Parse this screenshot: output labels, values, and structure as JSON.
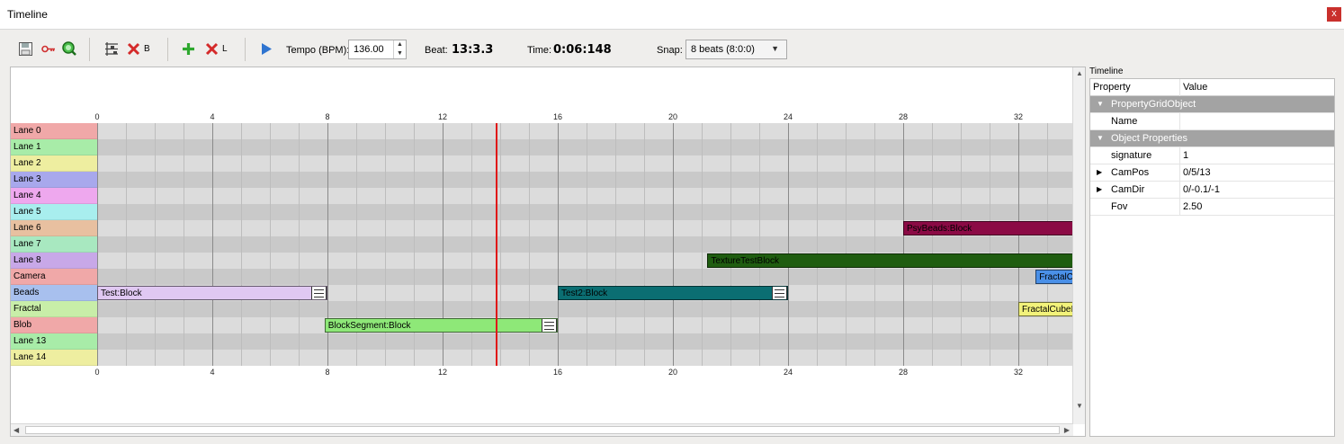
{
  "window": {
    "title": "Timeline",
    "close": "x"
  },
  "toolbar": {
    "remove_block_label": "B",
    "remove_lane_label": "L",
    "tempo_label": "Tempo (BPM):",
    "tempo_value": "136.00",
    "beat_label": "Beat:",
    "beat_value": "13:3.3",
    "time_label": "Time:",
    "time_value": "0:06:148",
    "snap_label": "Snap:",
    "snap_value": "8 beats (8:0:0)",
    "icons": [
      "save-icon",
      "key-icon",
      "zoom-icon",
      "lanes-icon",
      "delete-icon",
      "add-icon",
      "delete-icon",
      "play-icon"
    ]
  },
  "timeline": {
    "ticks": [
      "0",
      "4",
      "8",
      "12",
      "16",
      "20",
      "24",
      "28",
      "32"
    ],
    "tick_beats": [
      0,
      4,
      8,
      12,
      16,
      20,
      24,
      28,
      32
    ],
    "playhead_beat": 13.85,
    "lanes": [
      {
        "label": "Lane 0",
        "color": "#f0a8a8"
      },
      {
        "label": "Lane 1",
        "color": "#a8eca8"
      },
      {
        "label": "Lane 2",
        "color": "#eeeea0"
      },
      {
        "label": "Lane 3",
        "color": "#a8a8ec"
      },
      {
        "label": "Lane 4",
        "color": "#eea8ee"
      },
      {
        "label": "Lane 5",
        "color": "#a8eeee"
      },
      {
        "label": "Lane 6",
        "color": "#e8c0a0"
      },
      {
        "label": "Lane 7",
        "color": "#a8e8c0"
      },
      {
        "label": "Lane 8",
        "color": "#c8a8e8"
      },
      {
        "label": "Camera",
        "color": "#f0a8a8"
      },
      {
        "label": "Beads",
        "color": "#a8c0ee"
      },
      {
        "label": "Fractal",
        "color": "#c8eea8"
      },
      {
        "label": "Blob",
        "color": "#f0a8a8"
      },
      {
        "label": "Lane 13",
        "color": "#a8eca8"
      },
      {
        "label": "Lane 14",
        "color": "#eeeea0"
      }
    ],
    "blocks": [
      {
        "label": "PsyBeads:Block",
        "lane": 6,
        "start": 28,
        "end": 36,
        "color": "#8b0a45",
        "handle": false
      },
      {
        "label": "TextureTestBlock",
        "lane": 8,
        "start": 21.2,
        "end": 36,
        "color": "#1f5d10",
        "handle": false
      },
      {
        "label": "FractalC",
        "lane": 9,
        "start": 32.6,
        "end": 36,
        "color": "#4a90e8",
        "handle": false
      },
      {
        "label": "Test:Block",
        "lane": 10,
        "start": 0,
        "end": 8,
        "color": "#e0c8f2",
        "handle": true
      },
      {
        "label": "Test2:Block",
        "lane": 10,
        "start": 16,
        "end": 24,
        "color": "#0b6e72",
        "handle": true
      },
      {
        "label": "FractalCubeI",
        "lane": 11,
        "start": 32,
        "end": 36,
        "color": "#f2f27a",
        "handle": false
      },
      {
        "label": "BlockSegment:Block",
        "lane": 12,
        "start": 7.9,
        "end": 16,
        "color": "#8ee878",
        "handle": true
      }
    ]
  },
  "properties": {
    "panel_title": "Timeline",
    "header_property": "Property",
    "header_value": "Value",
    "rows": [
      {
        "type": "group",
        "key": "PropertyGridObject",
        "value": ""
      },
      {
        "type": "item",
        "key": "Name",
        "value": ""
      },
      {
        "type": "group",
        "key": "Object Properties",
        "value": ""
      },
      {
        "type": "item",
        "key": "signature",
        "value": "1"
      },
      {
        "type": "expandable",
        "key": "CamPos",
        "value": "0/5/13"
      },
      {
        "type": "expandable",
        "key": "CamDir",
        "value": "0/-0.1/-1"
      },
      {
        "type": "item",
        "key": "Fov",
        "value": "2.50"
      }
    ]
  }
}
